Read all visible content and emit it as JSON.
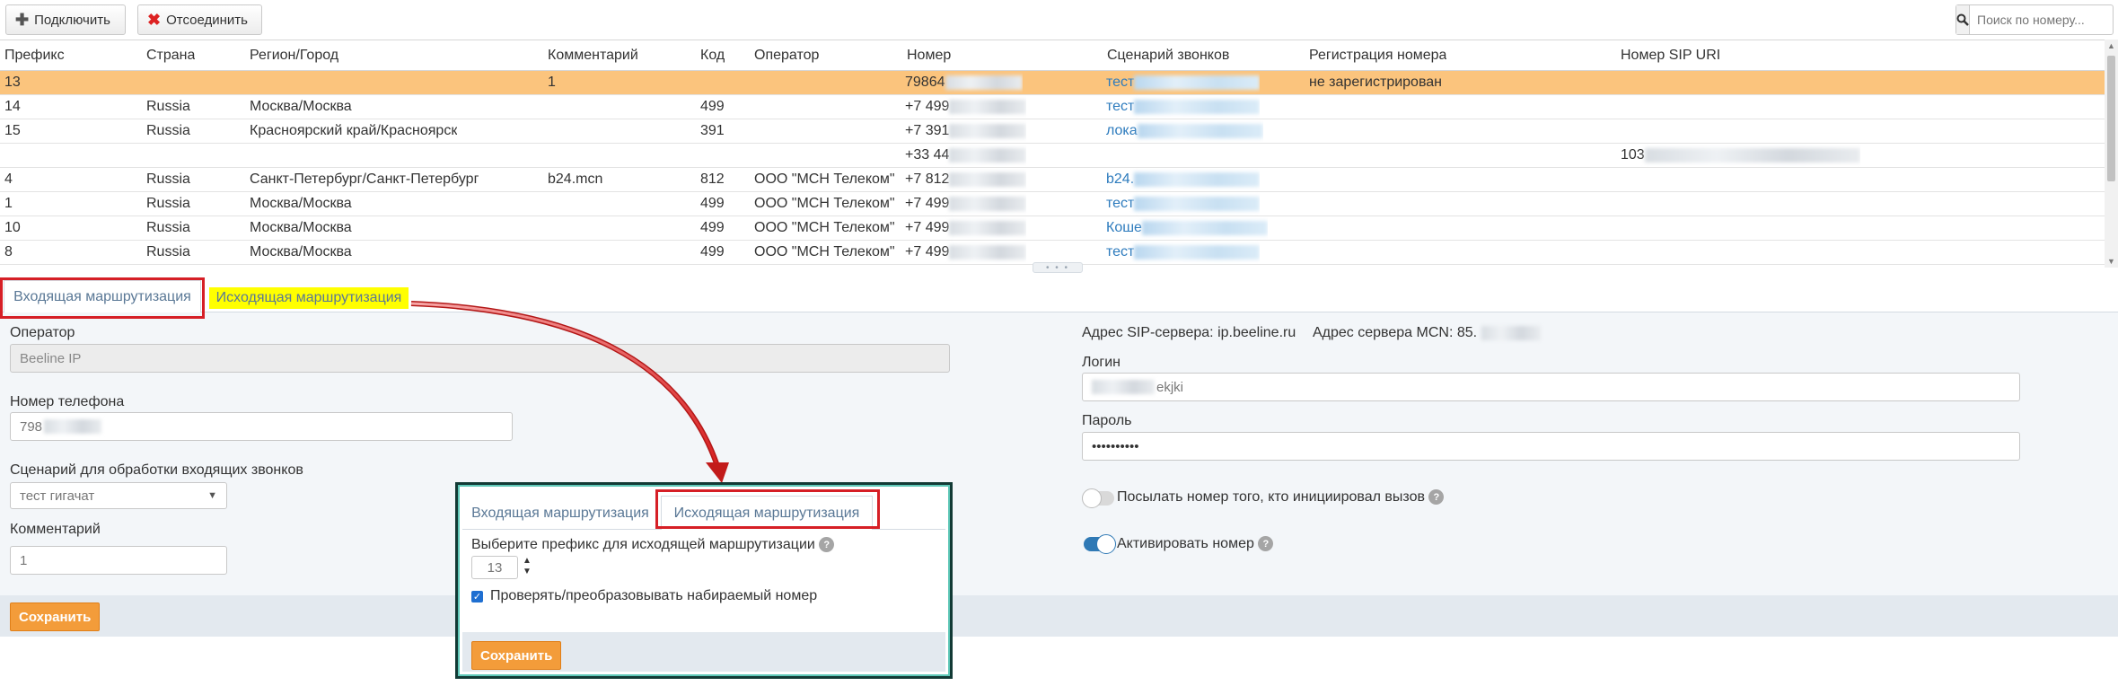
{
  "toolbar": {
    "connect_label": "Подключить",
    "disconnect_label": "Отсоединить",
    "search_placeholder": "Поиск по номеру..."
  },
  "table": {
    "columns": [
      "Префикс",
      "Страна",
      "Регион/Город",
      "Комментарий",
      "Код",
      "Оператор",
      "Номер",
      "Сценарий звонков",
      "Регистрация номера",
      "Номер SIP URI"
    ],
    "rows": [
      {
        "prefix": "13",
        "country": "",
        "region": "",
        "comment": "1",
        "code": "",
        "operator": "",
        "number": "79864",
        "scenario": "тест",
        "registration": "не зарегистрирован",
        "sip_uri": "",
        "selected": true
      },
      {
        "prefix": "14",
        "country": "Russia",
        "region": "Москва/Москва",
        "comment": "",
        "code": "499",
        "operator": "",
        "number": "+7 499",
        "scenario": "тест",
        "registration": "",
        "sip_uri": "",
        "selected": false
      },
      {
        "prefix": "15",
        "country": "Russia",
        "region": "Красноярский край/Красноярск",
        "comment": "",
        "code": "391",
        "operator": "",
        "number": "+7 391",
        "scenario": "лока",
        "registration": "",
        "sip_uri": "",
        "selected": false
      },
      {
        "prefix": "",
        "country": "",
        "region": "",
        "comment": "",
        "code": "",
        "operator": "",
        "number": "+33 44",
        "scenario": "",
        "registration": "",
        "sip_uri": "103",
        "selected": false
      },
      {
        "prefix": "4",
        "country": "Russia",
        "region": "Санкт-Петербург/Санкт-Петербург",
        "comment": "b24.mcn",
        "code": "812",
        "operator": "ООО \"МСН Телеком\"",
        "number": "+7 812",
        "scenario": "b24.",
        "registration": "",
        "sip_uri": "",
        "selected": false
      },
      {
        "prefix": "1",
        "country": "Russia",
        "region": "Москва/Москва",
        "comment": "",
        "code": "499",
        "operator": "ООО \"МСН Телеком\"",
        "number": "+7 499",
        "scenario": "тест",
        "registration": "",
        "sip_uri": "",
        "selected": false
      },
      {
        "prefix": "10",
        "country": "Russia",
        "region": "Москва/Москва",
        "comment": "",
        "code": "499",
        "operator": "ООО \"МСН Телеком\"",
        "number": "+7 499",
        "scenario": "Коше",
        "registration": "",
        "sip_uri": "",
        "selected": false
      },
      {
        "prefix": "8",
        "country": "Russia",
        "region": "Москва/Москва",
        "comment": "",
        "code": "499",
        "operator": "ООО \"МСН Телеком\"",
        "number": "+7 499",
        "scenario": "тест",
        "registration": "",
        "sip_uri": "",
        "selected": false
      }
    ]
  },
  "tabs": {
    "incoming": "Входящая маршрутизация",
    "outgoing": "Исходящая маршрутизация"
  },
  "form": {
    "operator_label": "Оператор",
    "operator_value": "Beeline IP",
    "phone_label": "Номер телефона",
    "phone_value": "798",
    "scenario_label": "Сценарий для обработки входящих звонков",
    "scenario_value": "тест гигачат",
    "comment_label": "Комментарий",
    "comment_value": "1",
    "save_label": "Сохранить"
  },
  "sip": {
    "server_text": "Адрес SIP-сервера: ip.beeline.ru",
    "mcn_server_text": "Адрес сервера MCN: 85.",
    "login_label": "Логин",
    "login_value": "ekjki",
    "password_label": "Пароль",
    "password_value": "••••••••••",
    "send_caller_label": "Посылать номер того, кто инициировал вызов",
    "send_caller_on": false,
    "activate_label": "Активировать номер",
    "activate_on": true
  },
  "popup": {
    "tab_incoming": "Входящая маршрутизация",
    "tab_outgoing": "Исходящая маршрутизация",
    "prefix_label": "Выберите префикс для исходящей маршрутизации",
    "prefix_value": "13",
    "check_label": "Проверять/преобразовывать набираемый номер",
    "check_on": true,
    "save_label": "Сохранить"
  },
  "colors": {
    "selected_row": "#fbc47d",
    "highlight_tab": "#ffff00",
    "link": "#2d7bbd",
    "save_button": "#f39c3a",
    "annotation_red": "#d61f26"
  }
}
